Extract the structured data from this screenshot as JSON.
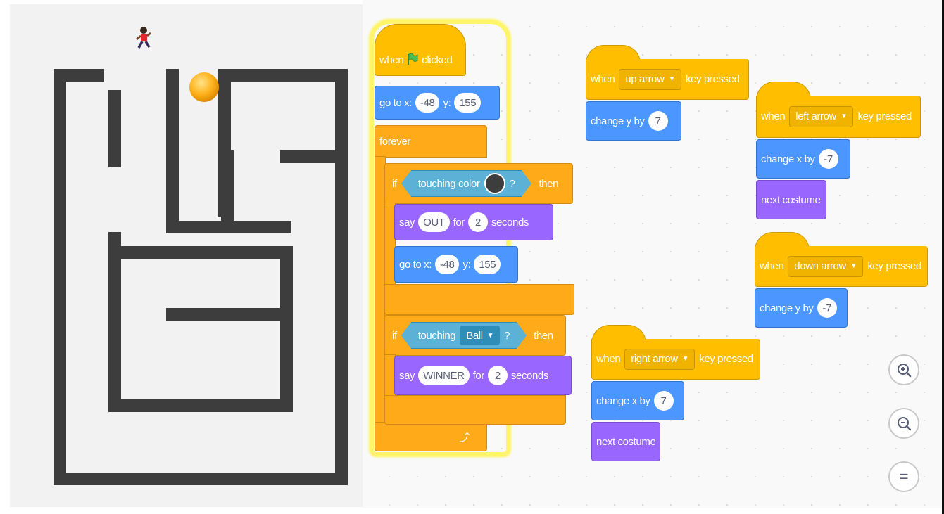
{
  "stage": {
    "sprites": {
      "runner": "runner-sprite",
      "ball": "Ball"
    }
  },
  "scripts": {
    "main": {
      "hat_when": "when",
      "hat_clicked": "clicked",
      "goto_label": "go to x:",
      "goto_x": "-48",
      "goto_y_label": "y:",
      "goto_y": "155",
      "forever": "forever",
      "if1_if": "if",
      "touching_color": "touching color",
      "question": "?",
      "then": "then",
      "say": "say",
      "say1_text": "OUT",
      "for": "for",
      "say1_secs": "2",
      "seconds": "seconds",
      "goto2_x": "-48",
      "goto2_y": "155",
      "if2_if": "if",
      "touching": "touching",
      "touching_target": "Ball",
      "say2_text": "WINNER",
      "say2_secs": "2",
      "loop_arrow": "⤴"
    },
    "up": {
      "when": "when",
      "key": "up arrow",
      "pressed": "key pressed",
      "action": "change y by",
      "value": "7"
    },
    "left": {
      "when": "when",
      "key": "left arrow",
      "pressed": "key pressed",
      "action": "change x by",
      "value": "-7",
      "next": "next costume"
    },
    "down": {
      "when": "when",
      "key": "down arrow",
      "pressed": "key pressed",
      "action": "change y by",
      "value": "-7"
    },
    "right": {
      "when": "when",
      "key": "right arrow",
      "pressed": "key pressed",
      "action": "change x by",
      "value": "7",
      "next": "next costume"
    }
  },
  "zoom": {
    "in": "zoom-in",
    "out": "zoom-out",
    "reset": "="
  },
  "colors": {
    "events": "#ffbf00",
    "motion": "#4c97ff",
    "looks": "#9966ff",
    "control": "#ffab19",
    "sensing": "#5cb1d6",
    "maze_wall": "#3d3d3d",
    "touch_color": "#3d3d3d"
  }
}
